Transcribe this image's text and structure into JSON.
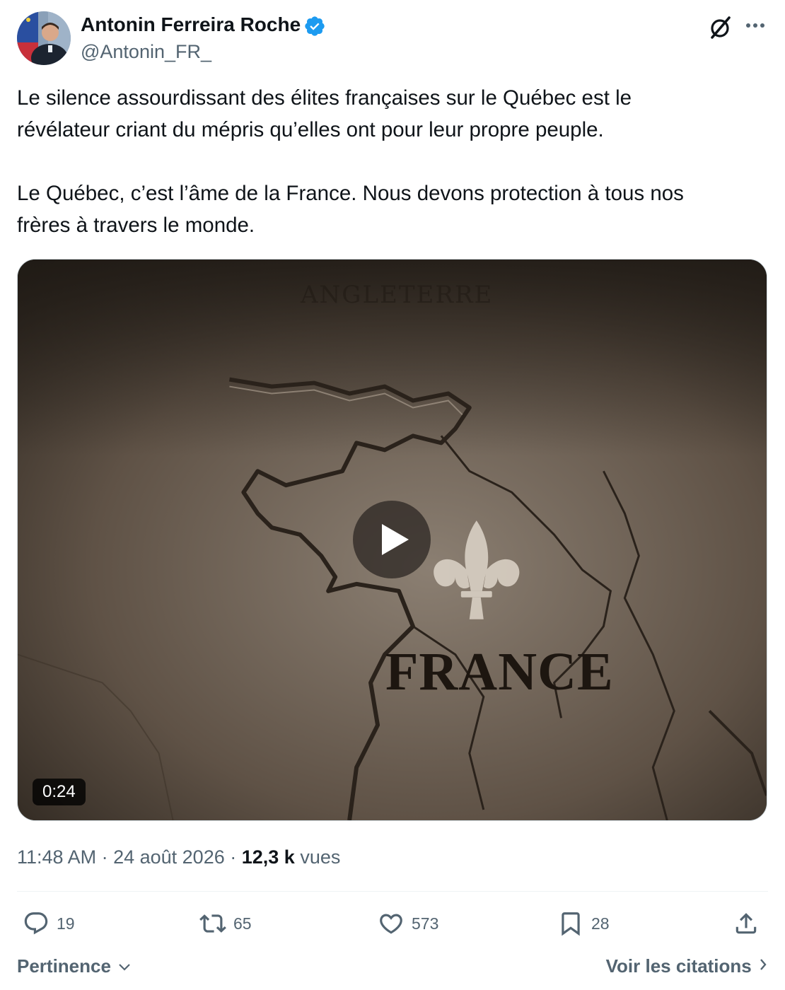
{
  "author": {
    "name": "Antonin Ferreira Roche",
    "handle": "@Antonin_FR_",
    "verified_color": "#1d9bf0"
  },
  "tweet": {
    "paragraphs": [
      [
        "Le silence assourdissant des élites françaises sur le Québec est le",
        "révélateur criant du mépris qu’elles ont pour leur propre peuple."
      ],
      [
        "Le Québec, c’est l’âme de la France. Nous devons protection à tous nos",
        "frères à travers le monde."
      ]
    ]
  },
  "video": {
    "duration": "0:24",
    "map_label_top": "ANGLETERRE",
    "map_label_main": "FRANCE"
  },
  "meta": {
    "time": "11:48 AM",
    "sep": " · ",
    "date": "24 août 2026",
    "views_count": "12,3 k",
    "views_label": "vues"
  },
  "actions": {
    "replies": "19",
    "reposts": "65",
    "likes": "573",
    "bookmarks": "28"
  },
  "footer": {
    "sort_label": "Pertinence",
    "quotes_label": "Voir les citations"
  },
  "icons": {
    "grok": "grok-icon",
    "more": "more-icon",
    "reply": "reply-icon",
    "repost": "repost-icon",
    "like": "heart-icon",
    "bookmark": "bookmark-icon",
    "share": "share-icon",
    "play": "play-icon"
  }
}
